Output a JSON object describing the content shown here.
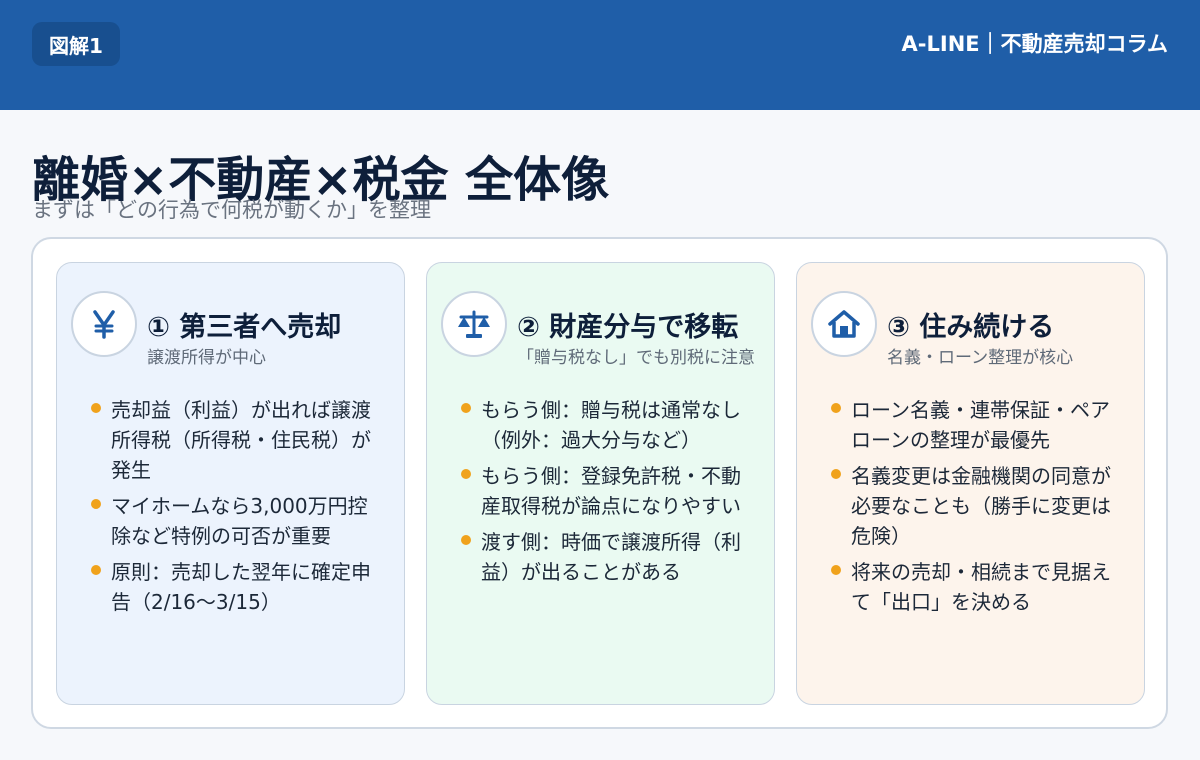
{
  "header": {
    "badge": "図解1",
    "brand": "A-LINE｜不動産売却コラム"
  },
  "title": "離婚×不動産×税金 全体像",
  "subtitle": "まずは「どの行為で何税が動くか」を整理",
  "colors": {
    "header_bg": "#1f5ea8",
    "accent_bullet": "#f0a21c",
    "card1_bg": "#ecf3fd",
    "card2_bg": "#eafaf2",
    "card3_bg": "#fdf4ec"
  },
  "cards": [
    {
      "icon": "yen-icon",
      "title": "① 第三者へ売却",
      "subtitle": "譲渡所得が中心",
      "bullets": [
        "売却益（利益）が出れば譲渡所得税（所得税・住民税）が発生",
        "マイホームなら3,000万円控除など特例の可否が重要",
        "原則：売却した翌年に確定申告（2/16〜3/15）"
      ]
    },
    {
      "icon": "scales-icon",
      "title": "② 財産分与で移転",
      "subtitle": "「贈与税なし」でも別税に注意",
      "bullets": [
        "もらう側：贈与税は通常なし（例外：過大分与など）",
        "もらう側：登録免許税・不動産取得税が論点になりやすい",
        "渡す側：時価で譲渡所得（利益）が出ることがある"
      ]
    },
    {
      "icon": "house-icon",
      "title": "③ 住み続ける",
      "subtitle": "名義・ローン整理が核心",
      "bullets": [
        "ローン名義・連帯保証・ペアローンの整理が最優先",
        "名義変更は金融機関の同意が必要なことも（勝手に変更は危険）",
        "将来の売却・相続まで見据えて「出口」を決める"
      ]
    }
  ]
}
